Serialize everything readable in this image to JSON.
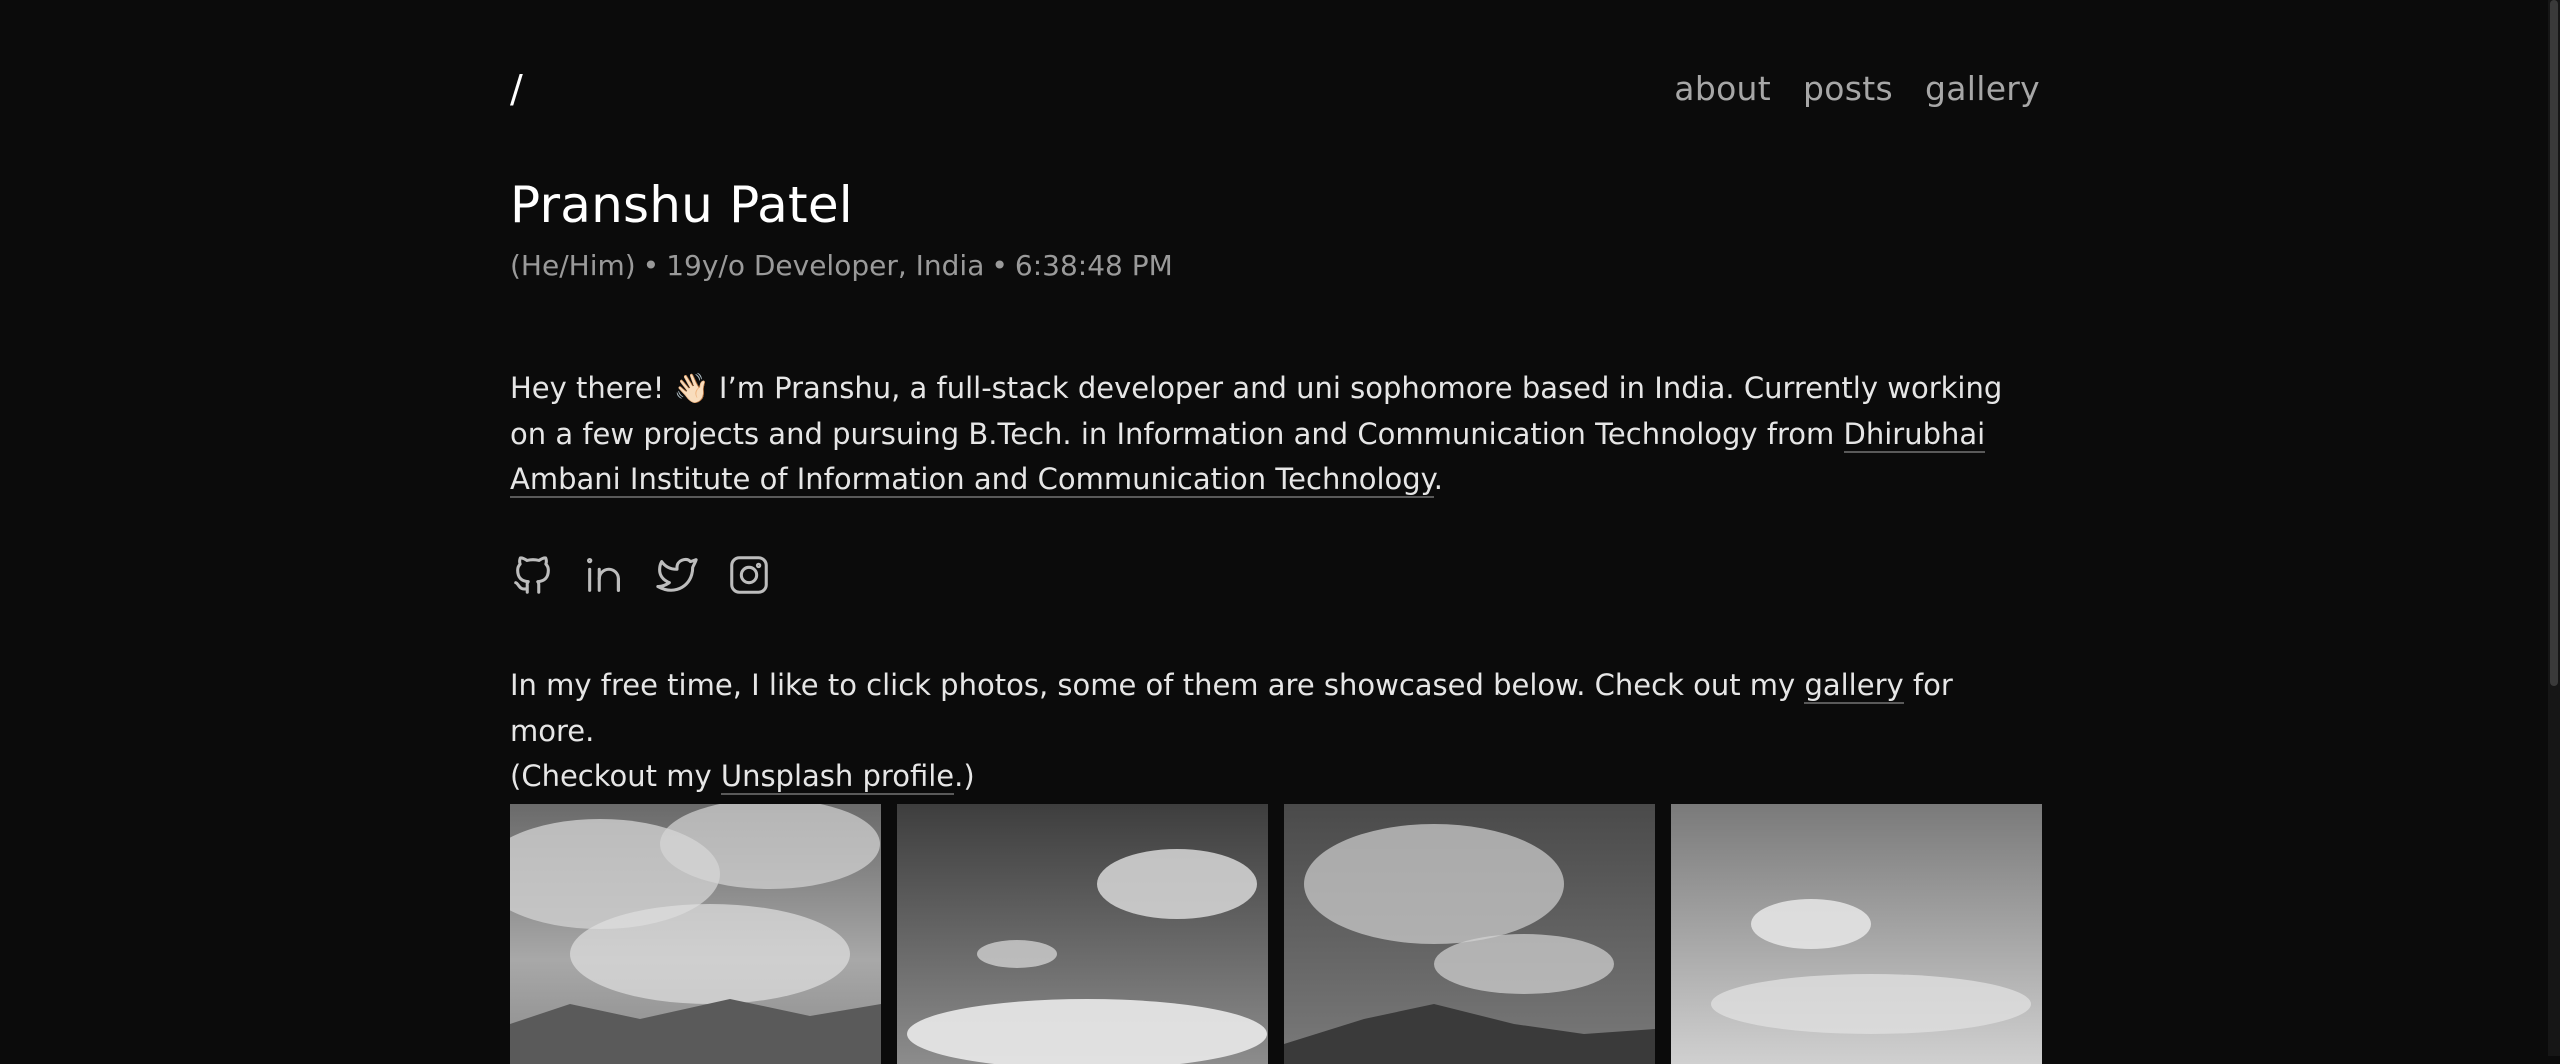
{
  "header": {
    "home_label": "/",
    "nav": [
      "about",
      "posts",
      "gallery"
    ]
  },
  "profile": {
    "name": "Pranshu Patel",
    "pronouns": "(He/Him)",
    "role": "19y/o Developer, India",
    "time": "6:38:48 PM",
    "separator": "•"
  },
  "intro": {
    "text_before": "Hey there! 👋🏻 I’m Pranshu, a full-stack developer and uni sophomore based in India. Currently working on a few projects and pursuing B.Tech. in Information and Communication Technology from ",
    "link_text": "Dhirubhai Ambani Institute of Information and Communication Technology",
    "text_after": "."
  },
  "socials": [
    "github-icon",
    "linkedin-icon",
    "twitter-icon",
    "instagram-icon"
  ],
  "photos_blurb": {
    "part1": "In my free time, I like to click photos, some of them are showcased below. Check out my ",
    "gallery_link": "gallery",
    "part2": " for more.",
    "part3": "(Checkout my ",
    "unsplash_link": "Unsplash profile",
    "part4": ".)"
  },
  "gallery": {
    "photos": [
      "photo-1",
      "photo-2",
      "photo-3",
      "photo-4"
    ]
  },
  "colors": {
    "background": "#0b0b0b",
    "text": "#e6e6e6",
    "muted": "#9a9a9a"
  }
}
